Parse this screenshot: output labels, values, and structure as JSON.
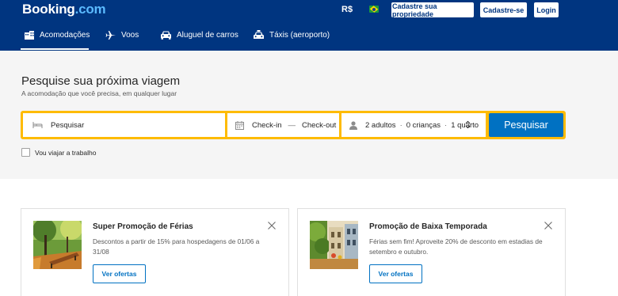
{
  "header": {
    "logo_main": "Booking",
    "logo_suffix": ".com",
    "currency": "R$",
    "flag_icon": "brazil-flag-icon",
    "list_property": "Cadastre sua propriedade",
    "register": "Cadastre-se",
    "login": "Login"
  },
  "nav": {
    "items": [
      {
        "label": "Acomodações",
        "icon": "bed-icon",
        "active": true
      },
      {
        "label": "Voos",
        "icon": "plane-icon",
        "active": false
      },
      {
        "label": "Aluguel de carros",
        "icon": "car-icon",
        "active": false
      },
      {
        "label": "Táxis (aeroporto)",
        "icon": "taxi-icon",
        "active": false
      }
    ]
  },
  "search": {
    "title": "Pesquise sua próxima viagem",
    "subtitle": "A acomodação que você precisa, em qualquer lugar",
    "destination_placeholder": "Pesquisar",
    "checkin": "Check-in",
    "date_separator": "—",
    "checkout": "Check-out",
    "adults": "2 adultos",
    "children": "0 crianças",
    "rooms": "1 quarto",
    "separator": "·",
    "button": "Pesquisar",
    "work_trip_label": "Vou viajar a trabalho",
    "work_trip_checked": false
  },
  "promos": [
    {
      "title": "Super Promoção de Férias",
      "text": "Descontos a partir de 15% para hospedagens de 01/06 a 31/08",
      "button": "Ver ofertas"
    },
    {
      "title": "Promoção de Baixa Temporada",
      "text": "Férias sem fim! Aproveite 20% de desconto em estadias de setembro e outubro.",
      "button": "Ver ofertas"
    }
  ],
  "colors": {
    "brand_blue": "#003580",
    "accent_blue": "#0071c2",
    "search_border": "#febb02"
  }
}
